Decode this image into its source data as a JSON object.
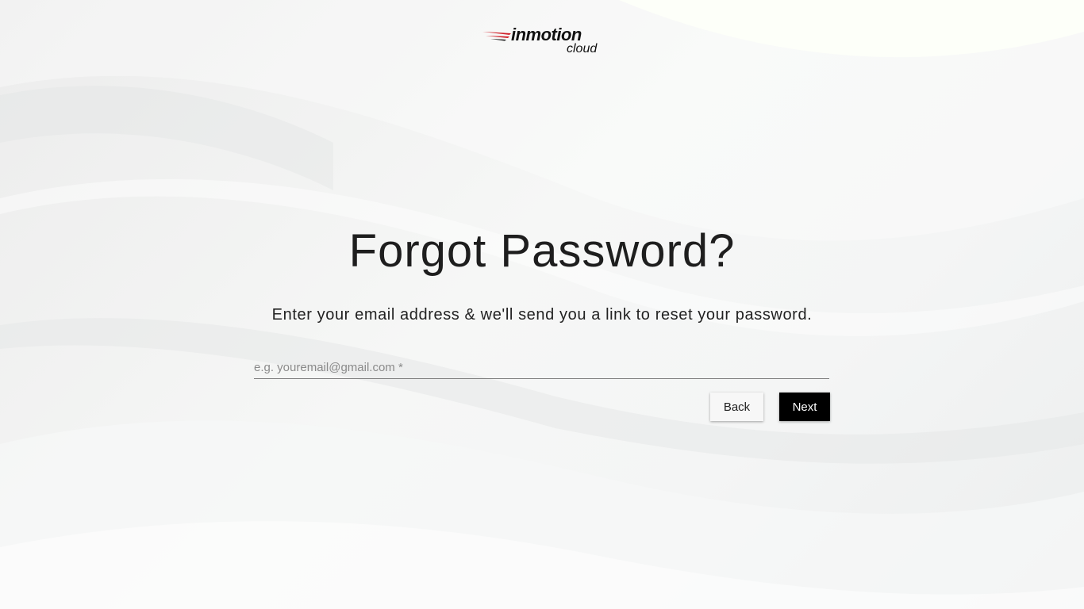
{
  "brand": {
    "name": "inmotion",
    "sub": "cloud",
    "accent_color": "#d0212a"
  },
  "page": {
    "title": "Forgot Password?",
    "subtitle": "Enter your email address & we'll send you a link to reset your password."
  },
  "form": {
    "email": {
      "value": "",
      "placeholder": "e.g. youremail@gmail.com *"
    },
    "back_label": "Back",
    "next_label": "Next"
  },
  "colors": {
    "background": "#f4f5f5",
    "primary_button": "#000000",
    "secondary_button": "#f7f7f7"
  }
}
